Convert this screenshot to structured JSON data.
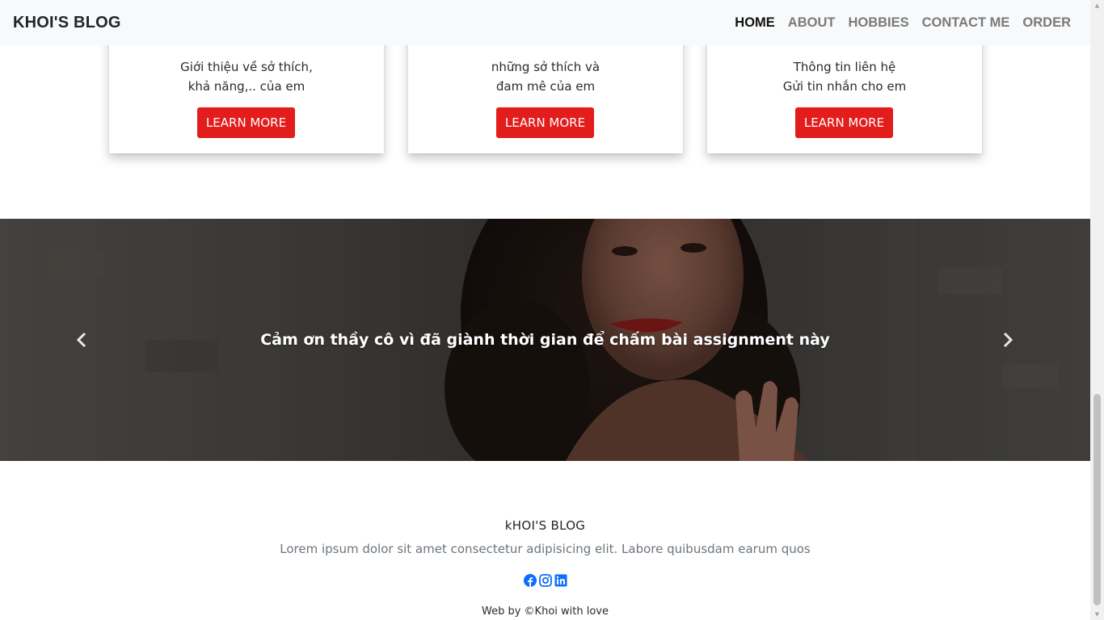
{
  "navbar": {
    "brand": "KHOI'S BLOG",
    "links": [
      {
        "label": "HOME",
        "active": true
      },
      {
        "label": "ABOUT",
        "active": false
      },
      {
        "label": "HOBBIES",
        "active": false
      },
      {
        "label": "CONTACT ME",
        "active": false
      },
      {
        "label": "ORDER",
        "active": false
      }
    ]
  },
  "cards": [
    {
      "lines": [
        "Giới thiệu về sở thích,",
        "khả năng,.. của em"
      ],
      "button": "LEARN MORE"
    },
    {
      "lines": [
        "những sở thích và",
        "đam mê của em"
      ],
      "button": "LEARN MORE"
    },
    {
      "lines": [
        "Thông tin liên hệ",
        "Gửi tin nhắn cho em"
      ],
      "button": "LEARN MORE"
    }
  ],
  "carousel": {
    "caption": "Cảm ơn thầy cô vì đã giành thời gian để chấm bài assignment này",
    "prev_icon": "chevron-left-icon",
    "next_icon": "chevron-right-icon"
  },
  "footer": {
    "title": "kHOI'S BLOG",
    "description": "Lorem ipsum dolor sit amet consectetur adipisicing elit. Labore quibusdam earum quos",
    "socials": [
      "facebook-icon",
      "instagram-icon",
      "linkedin-icon"
    ],
    "credit": "Web by ©Khoi with love"
  },
  "colors": {
    "accent_red": "#e31c1c",
    "navbar_bg": "#f8f9fa",
    "social_blue": "#0d6efd"
  }
}
